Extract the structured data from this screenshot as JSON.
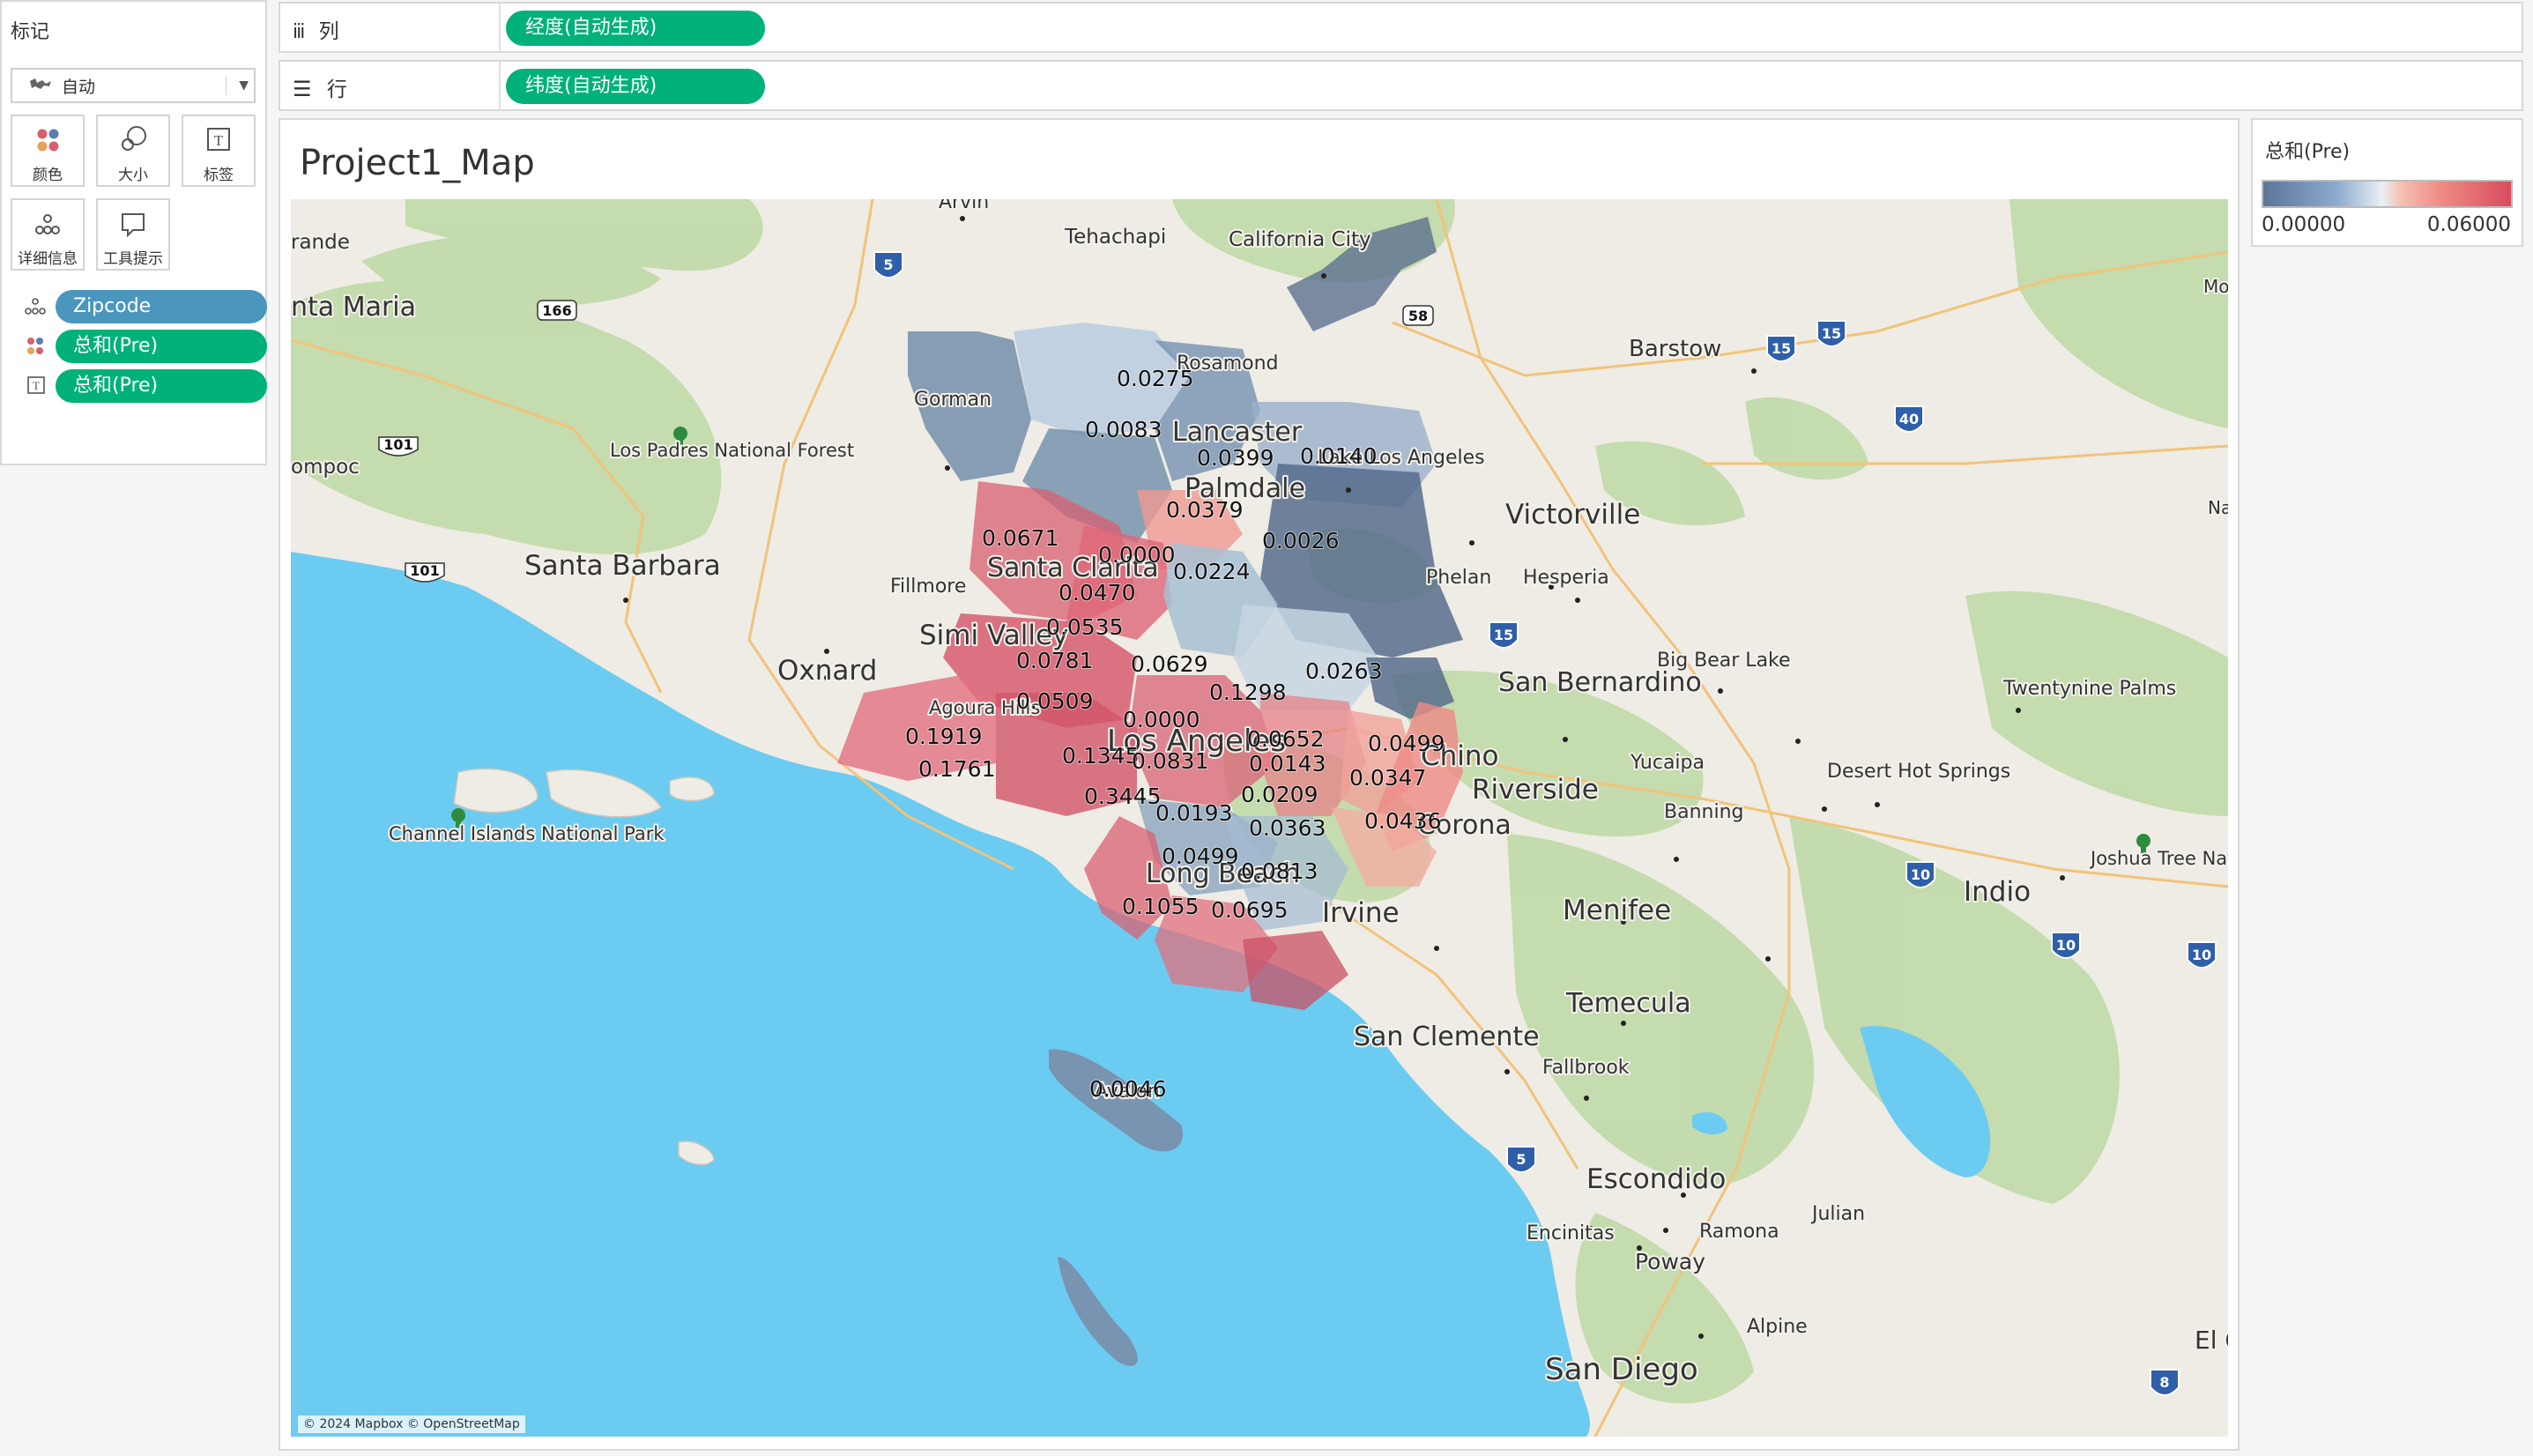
{
  "marks_card": {
    "title": "标记",
    "mark_type": "自动",
    "buttons": [
      {
        "label": "颜色",
        "icon": "color-icon"
      },
      {
        "label": "大小",
        "icon": "size-icon"
      },
      {
        "label": "标签",
        "icon": "label-icon"
      },
      {
        "label": "详细信息",
        "icon": "detail-icon"
      },
      {
        "label": "工具提示",
        "icon": "tooltip-icon"
      }
    ],
    "fields": [
      {
        "label": "Zipcode",
        "encoding": "detail",
        "icon": "detail-icon",
        "color": "#4b96bd"
      },
      {
        "label": "总和(Pre)",
        "encoding": "color",
        "icon": "color-icon",
        "color": "#00b17a"
      },
      {
        "label": "总和(Pre)",
        "encoding": "label",
        "icon": "label-icon",
        "color": "#00b17a"
      }
    ]
  },
  "shelves": {
    "columns": {
      "label": "列",
      "icon": "columns-icon",
      "pill": "经度(自动生成)"
    },
    "rows": {
      "label": "行",
      "icon": "rows-icon",
      "pill": "纬度(自动生成)"
    }
  },
  "sheet": {
    "title": "Project1_Map",
    "attribution": "© 2024 Mapbox © OpenStreetMap"
  },
  "legend": {
    "title": "总和(Pre)",
    "min": "0.00000",
    "max": "0.06000",
    "colors": {
      "low": "#5b7698",
      "mid": "#eaf0f6",
      "high": "#d94c5f"
    }
  },
  "map": {
    "city_labels": {
      "arvin": "Arvin",
      "tehachapi": "Tehachapi",
      "california_city": "California City",
      "grande": "rande",
      "santa_maria": "nta Maria",
      "gorman": "Gorman",
      "rosamond": "Rosamond",
      "barstow": "Barstow",
      "lancaster": "Lancaster",
      "lake_los_angeles": "Lake Los Angeles",
      "palmdale": "Palmdale",
      "los_padres": "Los Padres National Forest",
      "lompoc": "ompoc",
      "victorville": "Victorville",
      "santa_barbara": "Santa Barbara",
      "santa_clarita": "Santa Clarita",
      "phelan": "Phelan",
      "hesperia": "Hesperia",
      "fillmore": "Fillmore",
      "simi_valley": "Simi Valley",
      "oxnard": "Oxnard",
      "san_bernardino": "San Bernardino",
      "big_bear_lake": "Big Bear Lake",
      "twentynine_palms": "Twentynine Palms",
      "agoura_hills": "Agoura Hills",
      "los_angeles": "Los Angeles",
      "chino": "Chino",
      "yucaipa": "Yucaipa",
      "riverside": "Riverside",
      "desert_hot_springs": "Desert Hot Springs",
      "banning": "Banning",
      "channel_islands": "Channel Islands National Park",
      "corona": "Corona",
      "joshua_tree": "Joshua Tree National Park",
      "indio": "Indio",
      "long_beach": "Long Beach",
      "irvine": "Irvine",
      "menifee": "Menifee",
      "temecula": "Temecula",
      "san_clemente": "San Clemente",
      "fallbrook": "Fallbrook",
      "avalon": "Avalon",
      "escondido": "Escondido",
      "encinitas": "Encinitas",
      "ramona": "Ramona",
      "julian": "Julian",
      "poway": "Poway",
      "alpine": "Alpine",
      "san_diego": "San Diego",
      "el_centro": "El C",
      "mo": "Mo",
      "na": "Na"
    },
    "highway_shields": [
      "5",
      "58",
      "15",
      "15",
      "40",
      "166",
      "101",
      "101",
      "15",
      "10",
      "10",
      "10",
      "5",
      "8"
    ],
    "value_labels": [
      "0.0275",
      "0.0083",
      "0.0399",
      "0.0140",
      "0.0379",
      "0.0026",
      "0.0671",
      "0.0000",
      "0.0224",
      "0.0470",
      "0.0535",
      "0.0781",
      "0.0629",
      "0.0263",
      "0.0509",
      "0.1298",
      "0.0000",
      "0.0652",
      "0.1919",
      "0.0499",
      "0.1345",
      "0.0831",
      "0.0143",
      "0.1761",
      "0.0347",
      "0.3445",
      "0.0209",
      "0.0193",
      "0.0363",
      "0.0436",
      "0.0499",
      "0.0813",
      "0.1055",
      "0.0695",
      "0.0046"
    ]
  }
}
